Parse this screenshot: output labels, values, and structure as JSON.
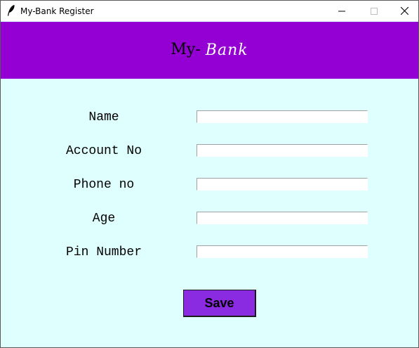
{
  "window": {
    "title": "My-Bank Register",
    "icon": "feather-icon",
    "controls": {
      "minimize": "minimize-icon",
      "maximize": "maximize-icon",
      "close": "close-icon"
    }
  },
  "header": {
    "title": "My-",
    "accent": "Bank",
    "background_color": "#9400d3",
    "accent_color": "#ffffff"
  },
  "form": {
    "background_color": "#dfffff",
    "fields": [
      {
        "label": "Name",
        "value": ""
      },
      {
        "label": "Account No",
        "value": ""
      },
      {
        "label": "Phone no",
        "value": ""
      },
      {
        "label": "Age",
        "value": ""
      },
      {
        "label": "Pin Number",
        "value": ""
      }
    ],
    "save_label": "Save",
    "save_color": "#8a2be2"
  }
}
